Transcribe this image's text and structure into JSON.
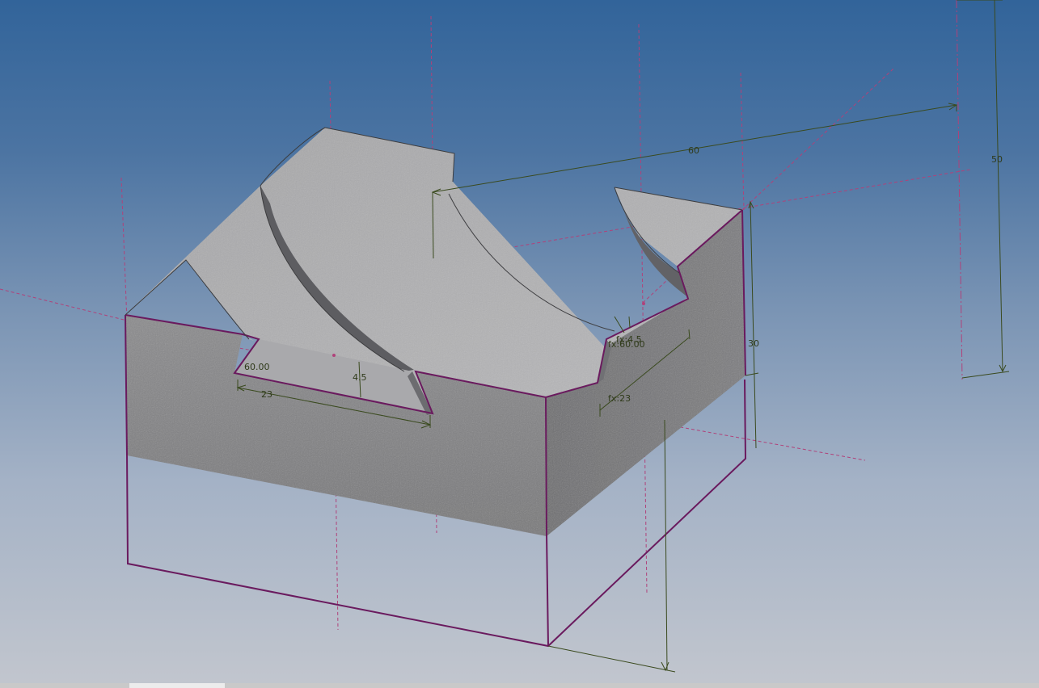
{
  "scene": {
    "background_top": "#32649a",
    "background_bottom": "#c2c6ce",
    "model_edge_color": "#6a1a5e",
    "centerline_color": "#b0427a",
    "dimension_color": "#3a4a1e"
  },
  "dimensions": {
    "length": "60",
    "height": "50",
    "depth": "30",
    "slot_angle": "60.00",
    "slot_depth": "4.5",
    "slot_width": "23",
    "right_slot_depth": "fx:4.5",
    "right_slot_angle": "fx:60.00",
    "right_slot_width": "fx:23"
  }
}
